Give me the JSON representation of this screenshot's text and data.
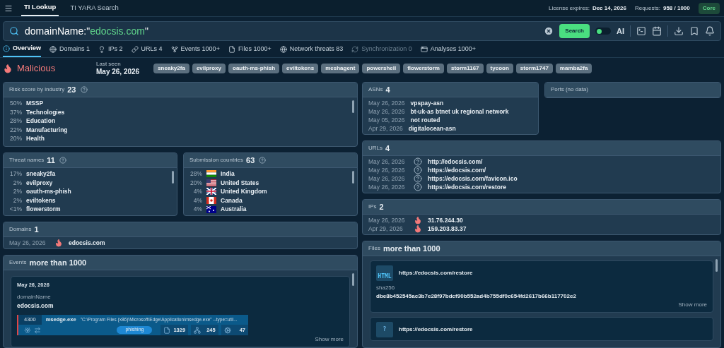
{
  "top_tabs": [
    {
      "label": "TI Lookup",
      "selected": true
    },
    {
      "label": "TI YARA Search",
      "selected": false
    }
  ],
  "license": {
    "label": "License expires:",
    "value": "Dec 14, 2026"
  },
  "requests": {
    "label": "Requests:",
    "value": "958 / 1000"
  },
  "plan_badge": "Core",
  "search": {
    "parts": [
      {
        "kind": "key",
        "text": "domainName:\""
      },
      {
        "kind": "value",
        "text": "edocsis.com"
      },
      {
        "kind": "key",
        "text": "\""
      }
    ],
    "button": "Search",
    "ai_toggle": {
      "label": "AI",
      "on": false
    }
  },
  "nav_tabs": [
    {
      "label": "Overview",
      "selected": true,
      "disabled": false
    },
    {
      "label": "Domains 1",
      "selected": false,
      "disabled": false
    },
    {
      "label": "IPs 2",
      "selected": false,
      "disabled": false
    },
    {
      "label": "URLs 4",
      "selected": false,
      "disabled": false
    },
    {
      "label": "Events 1000+",
      "selected": false,
      "disabled": false
    },
    {
      "label": "Files 1000+",
      "selected": false,
      "disabled": false
    },
    {
      "label": "Network threats 83",
      "selected": false,
      "disabled": false
    },
    {
      "label": "Synchronization 0",
      "selected": false,
      "disabled": true
    },
    {
      "label": "Analyses 1000+",
      "selected": false,
      "disabled": false
    }
  ],
  "verdict": {
    "label": "Malicious",
    "last_seen_label": "Last seen",
    "last_seen": "May 26, 2026",
    "tags": [
      "sneaky2fa",
      "evilproxy",
      "oauth-ms-phish",
      "eviltokens",
      "meshagent",
      "powershell",
      "flowerstorm",
      "storm1167",
      "tycoon",
      "storm1747",
      "mamba2fa"
    ]
  },
  "risk_by_industry": {
    "title": "Risk score by industry",
    "count": "23",
    "rows": [
      {
        "pct": "50%",
        "name": "MSSP"
      },
      {
        "pct": "37%",
        "name": "Technologies"
      },
      {
        "pct": "28%",
        "name": "Education"
      },
      {
        "pct": "22%",
        "name": "Manufacturing"
      },
      {
        "pct": "20%",
        "name": "Health"
      }
    ]
  },
  "threat_names": {
    "title": "Threat names",
    "count": "11",
    "rows": [
      {
        "pct": "17%",
        "name": "sneaky2fa"
      },
      {
        "pct": "2%",
        "name": "evilproxy"
      },
      {
        "pct": "2%",
        "name": "oauth-ms-phish"
      },
      {
        "pct": "2%",
        "name": "eviltokens"
      },
      {
        "pct": "<1%",
        "name": "flowerstorm"
      }
    ]
  },
  "submission_countries": {
    "title": "Submission countries",
    "count": "63",
    "rows": [
      {
        "pct": "28%",
        "name": "India",
        "kind": "in"
      },
      {
        "pct": "20%",
        "name": "United States",
        "kind": "us"
      },
      {
        "pct": "4%",
        "name": "United Kingdom",
        "kind": "gb"
      },
      {
        "pct": "4%",
        "name": "Canada",
        "kind": "ca"
      },
      {
        "pct": "4%",
        "name": "Australia",
        "kind": "au"
      }
    ]
  },
  "domains": {
    "title": "Domains",
    "count": "1",
    "rows": [
      {
        "date": "May 26, 2026",
        "kind": "malicious",
        "value": "edocsis.com"
      }
    ]
  },
  "events": {
    "title": "Events",
    "count": "more than 1000",
    "cards": [
      {
        "date": "May 26, 2026",
        "field": "domainName",
        "value": "edocsis.com",
        "process": {
          "pid": "4300",
          "name": "msedge.exe",
          "command": "\"C:\\Program Files (x86)\\Microsoft\\Edge\\Application\\msedge.exe\" --type=util...",
          "tag": "phishing",
          "files": "1329",
          "network": "245",
          "modules": "47"
        },
        "show_more": "Show more"
      }
    ]
  },
  "asns": {
    "title": "ASNs",
    "count": "4",
    "rows": [
      {
        "date": "May 26, 2026",
        "value": "vpspay-asn"
      },
      {
        "date": "May 26, 2026",
        "value": "bt-uk-as btnet uk regional network"
      },
      {
        "date": "May 05, 2026",
        "value": "not routed"
      },
      {
        "date": "Apr 29, 2026",
        "value": "digitalocean-asn"
      }
    ]
  },
  "ports": {
    "title": "Ports (no data)"
  },
  "urls": {
    "title": "URLs",
    "count": "4",
    "rows": [
      {
        "date": "May 26, 2026",
        "kind": "unknown",
        "value": "http://edocsis.com/"
      },
      {
        "date": "May 26, 2026",
        "kind": "unknown",
        "value": "https://edocsis.com/"
      },
      {
        "date": "May 26, 2026",
        "kind": "unknown",
        "value": "https://edocsis.com/favicon.ico"
      },
      {
        "date": "May 26, 2026",
        "kind": "unknown",
        "value": "https://edocsis.com/restore"
      }
    ]
  },
  "ips": {
    "title": "IPs",
    "count": "2",
    "rows": [
      {
        "date": "May 26, 2026",
        "kind": "malicious",
        "value": "31.76.244.30"
      },
      {
        "date": "Apr 29, 2026",
        "kind": "malicious",
        "value": "159.203.83.37"
      }
    ]
  },
  "files": {
    "title": "Files",
    "count": "more than 1000",
    "cards": [
      {
        "kind": "html",
        "icon_label": "HTML",
        "url": "https://edocsis.com/restore",
        "hash_label": "sha256",
        "hash": "dbe8b452545ac3b7e28f97bdcf90b552ad4b755df0c654fd2617b66b117702e2",
        "show_more": "Show more"
      },
      {
        "kind": "unknown",
        "icon_label": "?",
        "url": "https://edocsis.com/restore"
      }
    ]
  }
}
